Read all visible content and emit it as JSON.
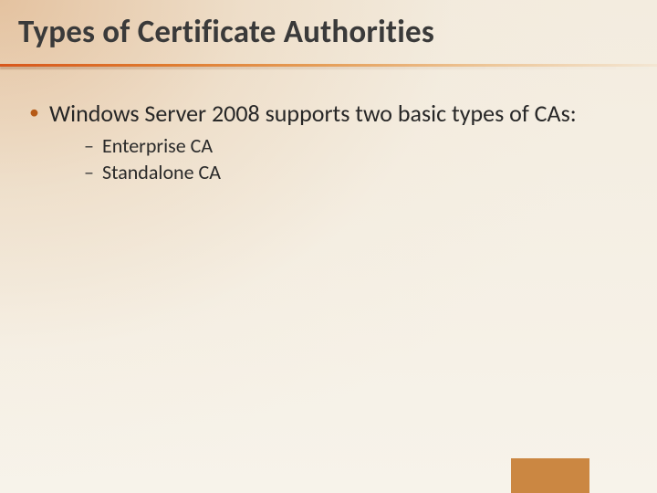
{
  "title": "Types of Certificate Authorities",
  "bullets": {
    "main": "Windows Server 2008 supports two basic types of CAs:",
    "subs": [
      "Enterprise CA",
      "Standalone CA"
    ]
  },
  "colors": {
    "accent": "#cb8742",
    "rule_start": "#d9571c",
    "bullet": "#b65a17"
  }
}
